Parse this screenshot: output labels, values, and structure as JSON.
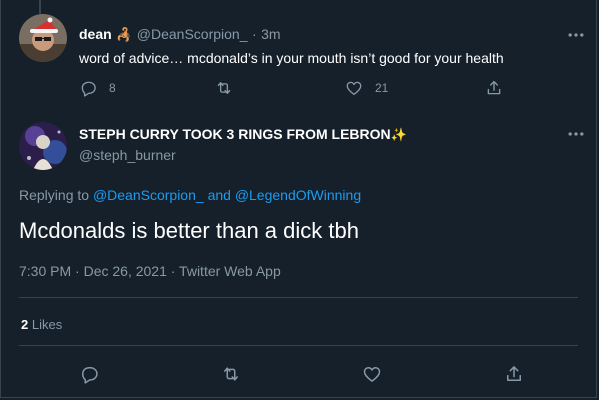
{
  "reply_tweet": {
    "display_name": "dean",
    "emoji": "🦂",
    "handle": "@DeanScorpion_",
    "dot": "·",
    "time": "3m",
    "text": "word of advice… mcdonald’s in your mouth isn’t good for your health",
    "reply_count": "8",
    "retweet_count": "",
    "like_count": "21"
  },
  "main_tweet": {
    "display_name": "STEPH CURRY TOOK 3 RINGS FROM LEBRON",
    "emoji": "✨",
    "handle": "@steph_burner",
    "replying_label": "Replying to",
    "replying_to_1": "@DeanScorpion_",
    "replying_and": "and",
    "replying_to_2": "@LegendOfWinning",
    "text": "Mcdonalds is better than a dick tbh",
    "meta": "7:30 PM · Dec 26, 2021 · Twitter Web App",
    "likes_count": "2",
    "likes_label": "Likes"
  },
  "colors": {
    "background": "#15202b",
    "border": "#38444d",
    "muted": "#8899a6",
    "accent": "#1d9bf0",
    "text": "#ffffff"
  },
  "icons": {
    "more": "more-horizontal-icon",
    "reply": "reply-icon",
    "retweet": "retweet-icon",
    "like": "heart-icon",
    "share": "share-icon"
  }
}
